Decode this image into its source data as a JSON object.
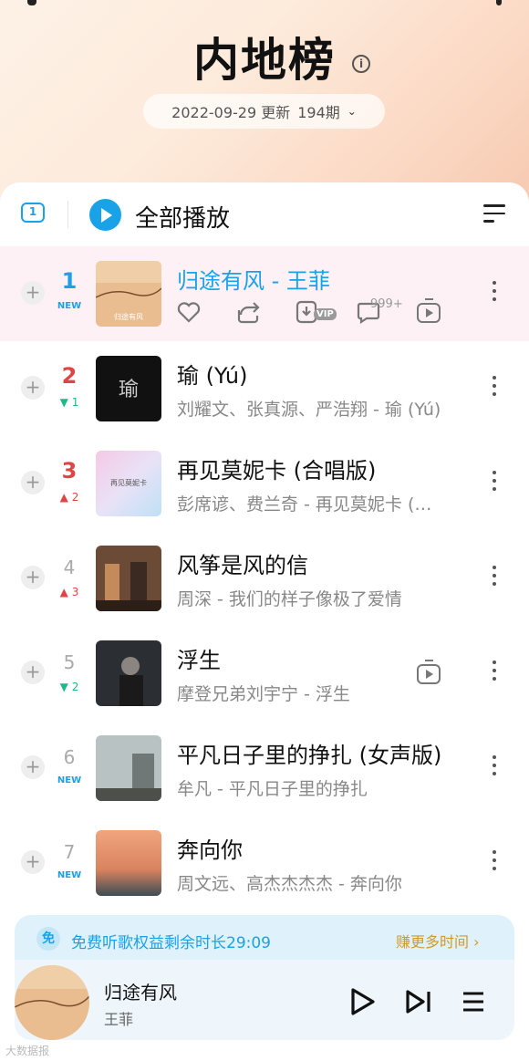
{
  "header": {
    "title": "内地榜",
    "date": "2022-09-29 更新",
    "issue": "194期"
  },
  "controls": {
    "play_all_label": "全部播放"
  },
  "songs": [
    {
      "rank": "1",
      "change": "NEW",
      "change_type": "new",
      "title": "归途有风 - 王菲",
      "artist": "",
      "cover_color": "#e8b98c"
    },
    {
      "rank": "2",
      "change": "▼ 1",
      "change_type": "down",
      "title": "瑜 (Yú)",
      "artist": "刘耀文、张真源、严浩翔 - 瑜 (Yú)",
      "cover_color": "#1b1b1b"
    },
    {
      "rank": "3",
      "change": "▲ 2",
      "change_type": "up",
      "title": "再见莫妮卡 (合唱版)",
      "artist": "彭席谚、费兰奇 - 再见莫妮卡 (合唱版)",
      "cover_color": "#e7dbf2"
    },
    {
      "rank": "4",
      "change": "▲ 3",
      "change_type": "up",
      "title": "风筝是风的信",
      "artist": "周深 - 我们的样子像极了爱情",
      "cover_color": "#5a3a2a"
    },
    {
      "rank": "5",
      "change": "▼ 2",
      "change_type": "down",
      "title": "浮生",
      "artist": "摩登兄弟刘宇宁 - 浮生",
      "cover_color": "#2a2a2a"
    },
    {
      "rank": "6",
      "change": "NEW",
      "change_type": "new",
      "title": "平凡日子里的挣扎 (女声版)",
      "artist": "牟凡 - 平凡日子里的挣扎",
      "cover_color": "#9aa7a8"
    },
    {
      "rank": "7",
      "change": "NEW",
      "change_type": "new",
      "title": "奔向你",
      "artist": "周文远、高杰杰杰杰 - 奔向你",
      "cover_color": "#c97f5a"
    }
  ],
  "first_song_actions": {
    "comment_count": "999+",
    "vip_badge": "VIP"
  },
  "promo": {
    "badge": "免",
    "text": "免费听歌权益剩余时长29:09",
    "link": "赚更多时间"
  },
  "player": {
    "title": "归途有风",
    "artist": "王菲"
  },
  "watermark": "大数据报",
  "colors": {
    "accent": "#1aa2e8",
    "rank_red": "#e04545",
    "rank_down": "#21b889",
    "promo_gold": "#d19a2a"
  }
}
